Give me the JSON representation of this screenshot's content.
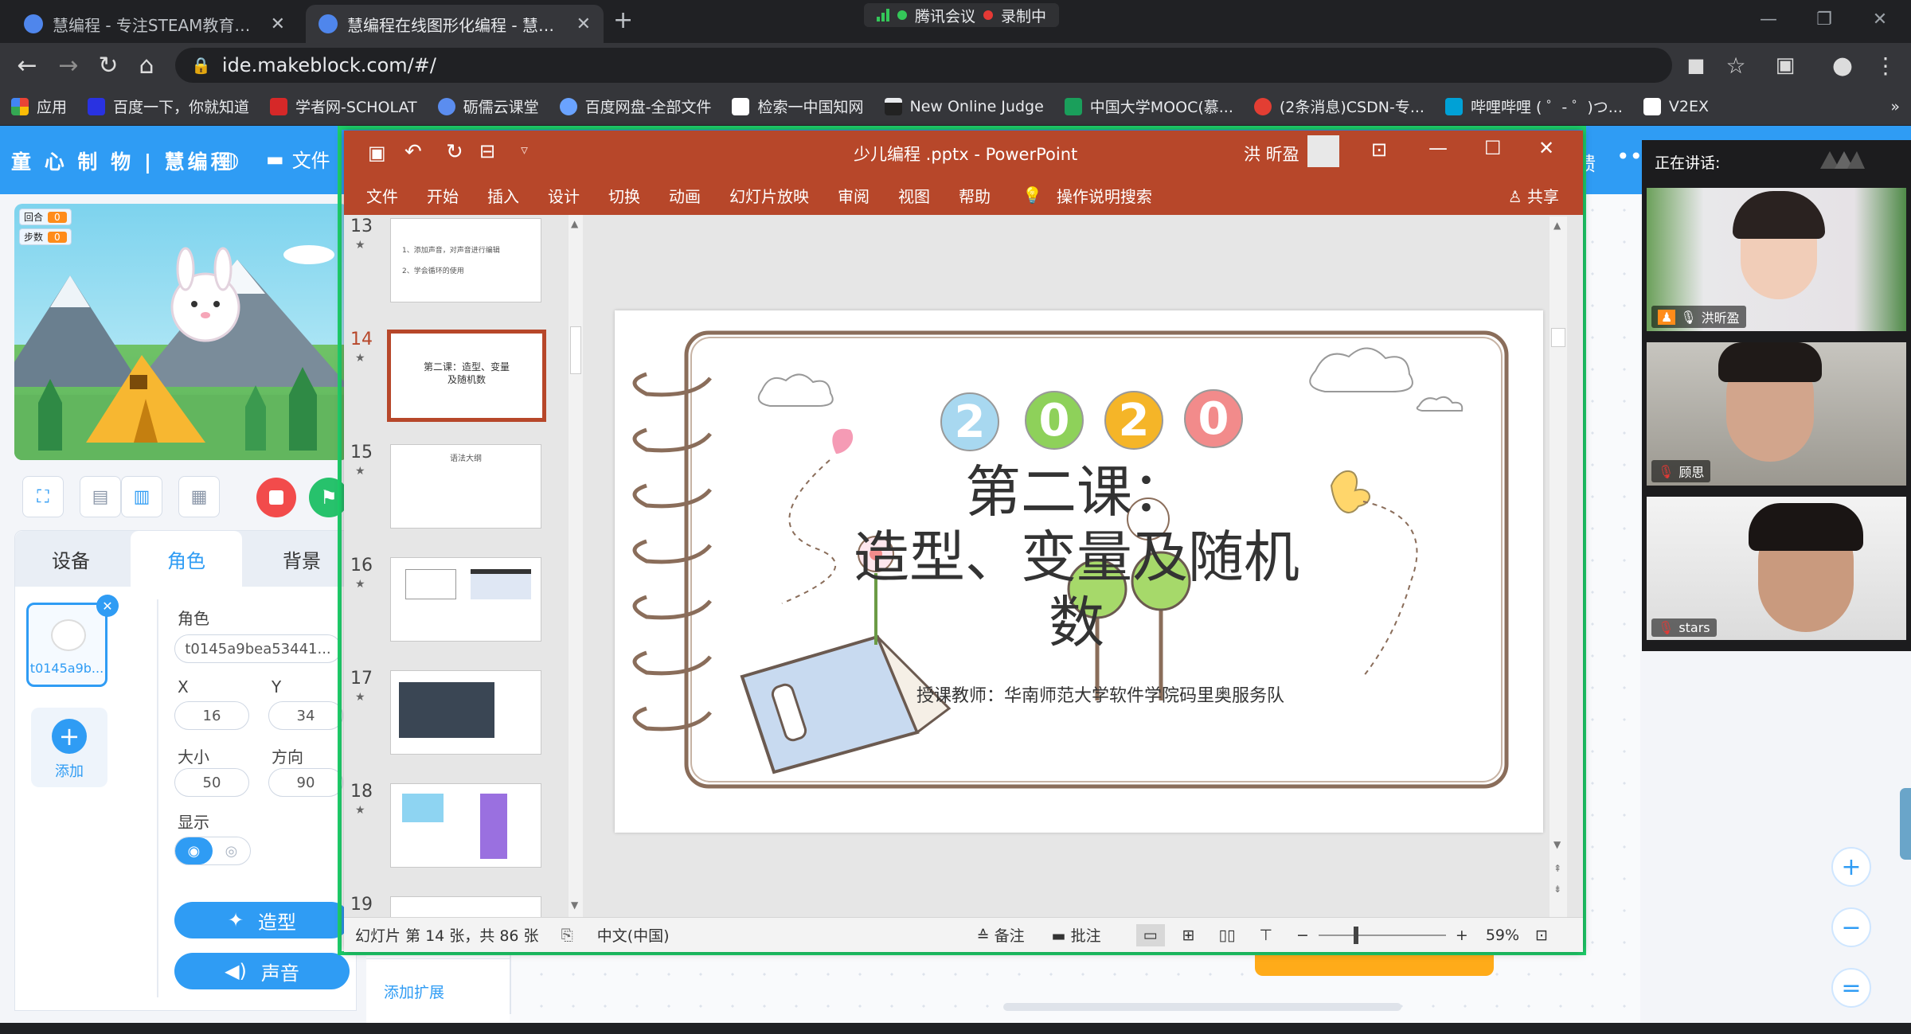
{
  "browser": {
    "tabs": [
      {
        "label": "慧编程 - 专注STEAM教育的编程",
        "close": "✕"
      },
      {
        "label": "慧编程在线图形化编程 - 慧编程",
        "close": "✕"
      }
    ],
    "new_tab": "+",
    "meeting": {
      "app": "腾讯会议",
      "recording": "录制中"
    },
    "url": "ide.makeblock.com/#/",
    "bookmarks": [
      "应用",
      "百度一下，你就知道",
      "学者网-SCHOLAT",
      "砺儒云课堂",
      "百度网盘-全部文件",
      "检索一中国知网",
      "New Online Judge",
      "中国大学MOOC(慕...",
      "(2条消息)CSDN-专...",
      "哔哩哔哩 ( ゜- ゜)つ...",
      "V2EX"
    ],
    "bookmarks_more": "»"
  },
  "app": {
    "logo": "童 心 制 物 | 慧编程",
    "file_menu": "文件",
    "feedback": "馈",
    "more": "•••",
    "stage_vars": [
      {
        "name": "回合",
        "value": "0"
      },
      {
        "name": "步数",
        "value": "0"
      }
    ],
    "panel_tabs": [
      "设备",
      "角色",
      "背景"
    ],
    "sprite": {
      "name_label": "角色",
      "name_value": "t0145a9bea53441...",
      "thumb_label": "t0145a9b...",
      "x_label": "X",
      "x_value": "16",
      "y_label": "Y",
      "y_value": "34",
      "size_label": "大小",
      "size_value": "50",
      "dir_label": "方向",
      "dir_value": "90",
      "show_label": "显示"
    },
    "add_label": "添加",
    "costume_btn": "造型",
    "sound_btn": "声音",
    "add_ext": "添加扩展",
    "zoom_in": "+",
    "zoom_out": "−",
    "zoom_reset": "="
  },
  "ppt": {
    "title": "少儿编程 .pptx  -  PowerPoint",
    "user": "洪 昕盈",
    "menu": [
      "文件",
      "开始",
      "插入",
      "设计",
      "切换",
      "动画",
      "幻灯片放映",
      "审阅",
      "视图",
      "帮助"
    ],
    "search": "操作说明搜索",
    "share": "共享",
    "thumb_numbers": [
      "13",
      "14",
      "15",
      "16",
      "17",
      "18",
      "19"
    ],
    "thumb13_lines": [
      "1、添加声音，对声音进行编辑",
      "2、学会循环的使用"
    ],
    "thumb14_text": "第二课：造型、变量及随机数",
    "thumb15_text": "语法大纲",
    "slide": {
      "year_digits": [
        "2",
        "0",
        "2",
        "0"
      ],
      "title_line1": "第二课：",
      "title_line2": "造型、变量及随机",
      "title_line3": "数",
      "teacher": "授课教师：华南师范大学软件学院码里奥服务队"
    },
    "status": {
      "slide_info": "幻灯片 第 14 张，共 86 张",
      "language": "中文(中国)",
      "notes": "备注",
      "comments": "批注",
      "zoom": "59%"
    },
    "colors": {
      "accent": "#b7472a"
    }
  },
  "meeting": {
    "speaking": "正在讲话:",
    "participants": [
      "洪昕盈",
      "顾思",
      "stars"
    ]
  }
}
